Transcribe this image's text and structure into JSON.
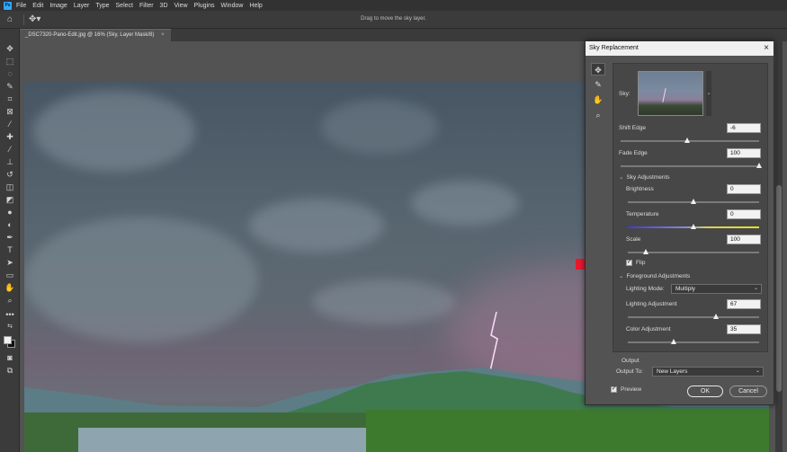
{
  "menu": [
    "File",
    "Edit",
    "Image",
    "Layer",
    "Type",
    "Select",
    "Filter",
    "3D",
    "View",
    "Plugins",
    "Window",
    "Help"
  ],
  "app_logo": "Ps",
  "options_bar": {
    "hint": "Drag to move the sky layer."
  },
  "document_tab": {
    "title": "_DSC7320-Pano-Edit.jpg @ 16% (Sky, Layer Mask/8)",
    "close": "×"
  },
  "dialog": {
    "title": "Sky Replacement",
    "close": "×",
    "sky_label": "Sky:",
    "shift_edge": {
      "label": "Shift Edge",
      "value": "-6",
      "position": 0.48
    },
    "fade_edge": {
      "label": "Fade Edge",
      "value": "100",
      "position": 1.0
    },
    "sky_adjustments": {
      "label": "Sky Adjustments",
      "brightness": {
        "label": "Brightness",
        "value": "0",
        "position": 0.5
      },
      "temperature": {
        "label": "Temperature",
        "value": "0",
        "position": 0.5
      },
      "scale": {
        "label": "Scale",
        "value": "100",
        "position": 0.14
      },
      "flip": {
        "label": "Flip",
        "checked": true
      }
    },
    "foreground_adjustments": {
      "label": "Foreground Adjustments",
      "lighting_mode": {
        "label": "Lighting Mode:",
        "value": "Multiply"
      },
      "lighting_adjustment": {
        "label": "Lighting Adjustment",
        "value": "67",
        "position": 0.67
      },
      "color_adjustment": {
        "label": "Color Adjustment",
        "value": "35",
        "position": 0.35
      }
    },
    "output": {
      "label": "Output",
      "output_to_label": "Output To:",
      "output_to_value": "New Layers"
    },
    "preview": {
      "label": "Preview",
      "checked": true
    },
    "ok_label": "OK",
    "cancel_label": "Cancel"
  },
  "colors": {
    "accent_arrow": "#e8192c",
    "temperature_cold": "#3b3bd8",
    "temperature_warm": "#e8e020"
  }
}
